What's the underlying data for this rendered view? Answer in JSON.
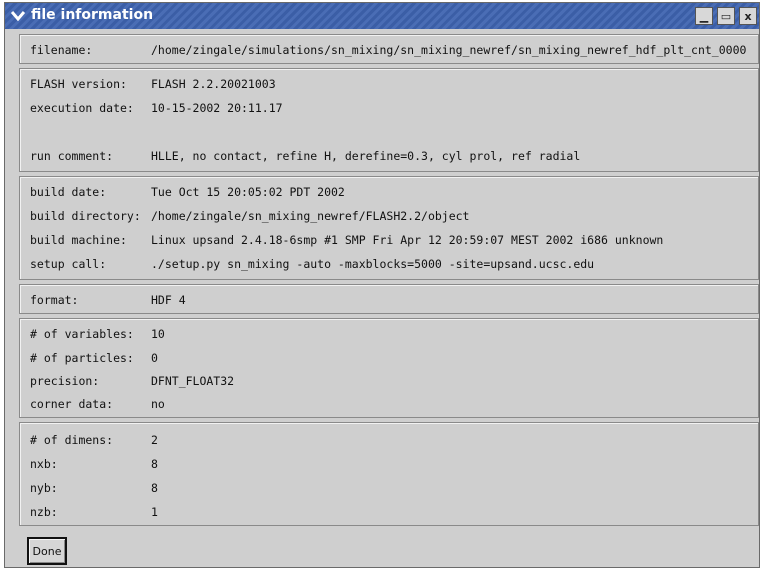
{
  "window": {
    "title": "file information",
    "minimize_glyph": "▁",
    "maximize_glyph": "▭",
    "close_glyph": "x"
  },
  "sections": {
    "file": [
      {
        "label": "filename:",
        "value": "/home/zingale/simulations/sn_mixing/sn_mixing_newref/sn_mixing_newref_hdf_plt_cnt_0000"
      }
    ],
    "run": [
      {
        "label": "FLASH version:",
        "value": "FLASH 2.2.20021003"
      },
      {
        "label": "execution date:",
        "value": "10-15-2002 20:11.17"
      },
      {
        "label": "run comment:",
        "value": "HLLE, no contact, refine H, derefine=0.3, cyl prol, ref radial"
      }
    ],
    "build": [
      {
        "label": "build date:",
        "value": "Tue Oct 15 20:05:02 PDT 2002"
      },
      {
        "label": "build directory:",
        "value": "/home/zingale/sn_mixing_newref/FLASH2.2/object"
      },
      {
        "label": "build machine:",
        "value": "Linux upsand 2.4.18-6smp #1 SMP Fri Apr 12 20:59:07 MEST 2002 i686 unknown"
      },
      {
        "label": "setup call:",
        "value": "./setup.py sn_mixing -auto -maxblocks=5000 -site=upsand.ucsc.edu"
      }
    ],
    "format": [
      {
        "label": "format:",
        "value": "HDF 4"
      }
    ],
    "variables": [
      {
        "label": "# of variables:",
        "value": "10"
      },
      {
        "label": "# of particles:",
        "value": "0"
      },
      {
        "label": "precision:",
        "value": "DFNT_FLOAT32"
      },
      {
        "label": "corner data:",
        "value": "no"
      }
    ],
    "dimens": [
      {
        "label": "# of dimens:",
        "value": "2"
      },
      {
        "label": "nxb:",
        "value": "8"
      },
      {
        "label": "nyb:",
        "value": "8"
      },
      {
        "label": "nzb:",
        "value": "1"
      }
    ]
  },
  "buttons": {
    "done_label": "Done"
  },
  "colors": {
    "titlebar": "#3b5ea6",
    "window_bg": "#cfcfcf"
  }
}
